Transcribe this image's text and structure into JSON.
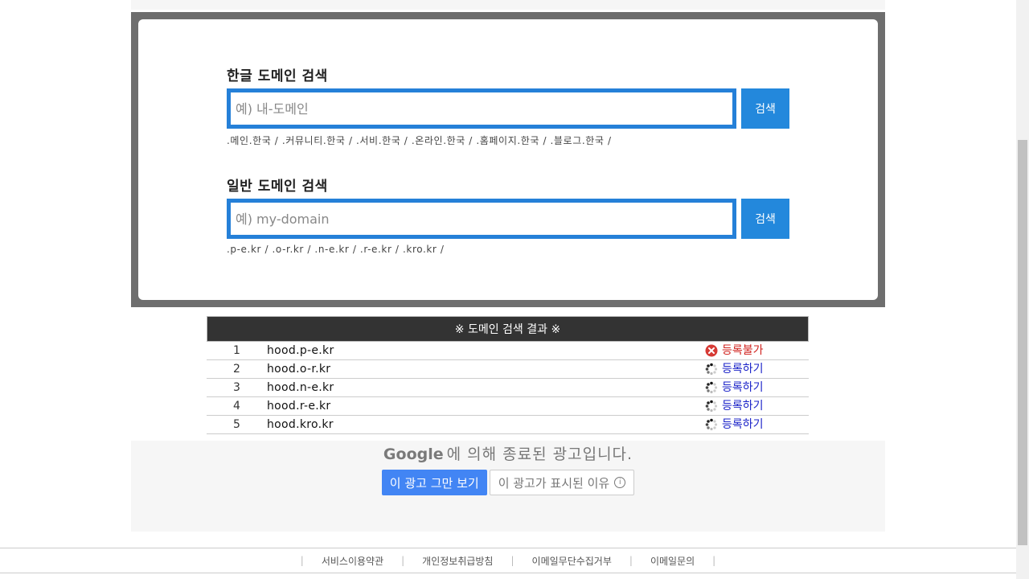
{
  "hangul_search": {
    "title": "한글 도메인 검색",
    "placeholder": "예) 내-도메인",
    "button_label": "검색",
    "tld_list": ".메인.한국 / .커뮤니티.한국 / .서비.한국 / .온라인.한국 / .홈페이지.한국 / .블로그.한국 /"
  },
  "general_search": {
    "title": "일반 도메인 검색",
    "placeholder": "예) my-domain",
    "button_label": "검색",
    "tld_list": ".p-e.kr / .o-r.kr / .n-e.kr / .r-e.kr / .kro.kr /"
  },
  "results": {
    "header": "※ 도메인 검색 결과 ※",
    "rows": [
      {
        "num": "1",
        "domain": "hood.p-e.kr",
        "status": "등록불가",
        "status_icon": "error-x-icon"
      },
      {
        "num": "2",
        "domain": "hood.o-r.kr",
        "status": "등록하기",
        "status_icon": "loading-spinner-icon"
      },
      {
        "num": "3",
        "domain": "hood.n-e.kr",
        "status": "등록하기",
        "status_icon": "loading-spinner-icon"
      },
      {
        "num": "4",
        "domain": "hood.r-e.kr",
        "status": "등록하기",
        "status_icon": "loading-spinner-icon"
      },
      {
        "num": "5",
        "domain": "hood.kro.kr",
        "status": "등록하기",
        "status_icon": "loading-spinner-icon"
      }
    ]
  },
  "ad": {
    "brand": "Google",
    "message": "에 의해 종료된 광고입니다.",
    "stop_label": "이 광고 그만 보기",
    "why_label": "이 광고가 표시된 이유"
  },
  "footer": {
    "links": [
      "서비스이용약관",
      "개인정보취급방침",
      "이메일무단수집거부",
      "이메일문의"
    ]
  },
  "colors": {
    "accent_blue": "#2388dc",
    "unavailable_red": "#d0201c",
    "available_blue": "#1a22c8",
    "google_blue": "#4285f4"
  }
}
